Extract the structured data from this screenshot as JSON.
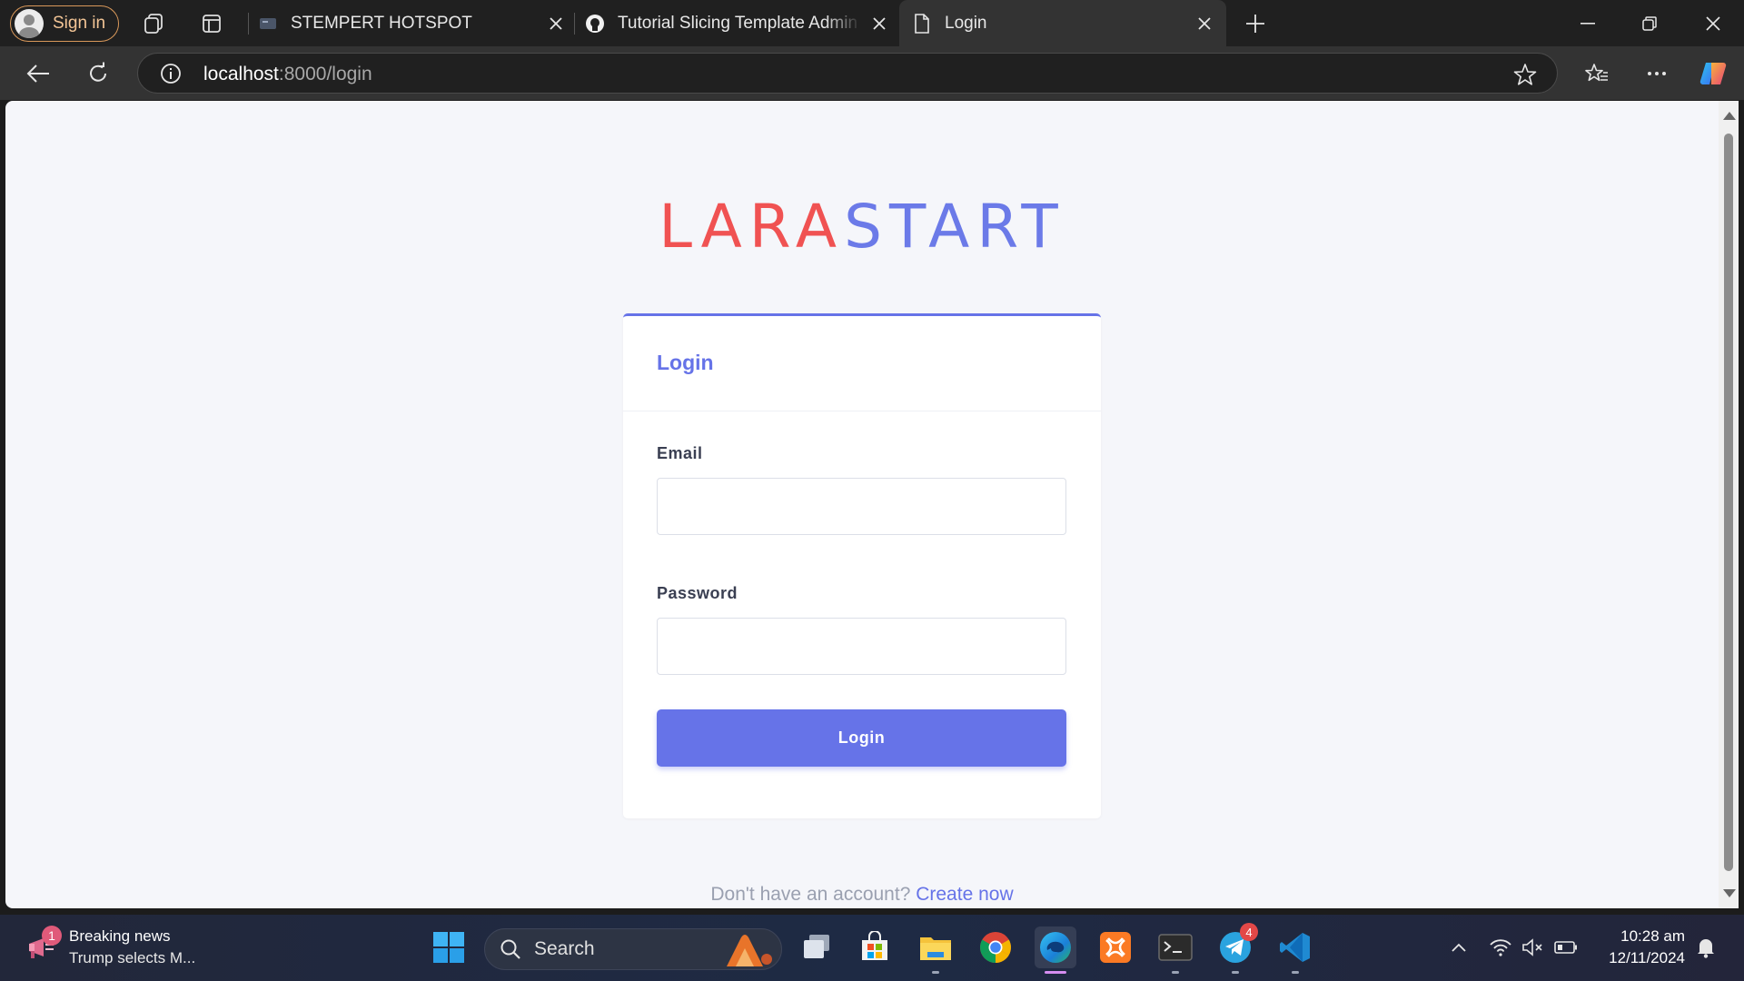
{
  "browser": {
    "signin_label": "Sign in",
    "tabs": [
      {
        "title": "STEMPERT HOTSPOT"
      },
      {
        "title": "Tutorial Slicing Template Admin S"
      },
      {
        "title": "Login"
      }
    ],
    "url_host": "localhost",
    "url_rest": ":8000/login"
  },
  "page": {
    "brand_part1": "LARA",
    "brand_part2": "START",
    "card_title": "Login",
    "email_label": "Email",
    "email_value": "",
    "password_label": "Password",
    "password_value": "",
    "login_button": "Login",
    "signup_prompt": "Don't have an account?",
    "signup_link": "Create now"
  },
  "taskbar": {
    "news_title": "Breaking news",
    "news_subtitle": "Trump selects M...",
    "news_badge": "1",
    "search_label": "Search",
    "telegram_badge": "4",
    "time": "10:28 am",
    "date": "12/11/2024"
  },
  "colors": {
    "accent": "#6673e8",
    "brand_red": "#f05252",
    "page_bg": "#f5f6fa"
  }
}
